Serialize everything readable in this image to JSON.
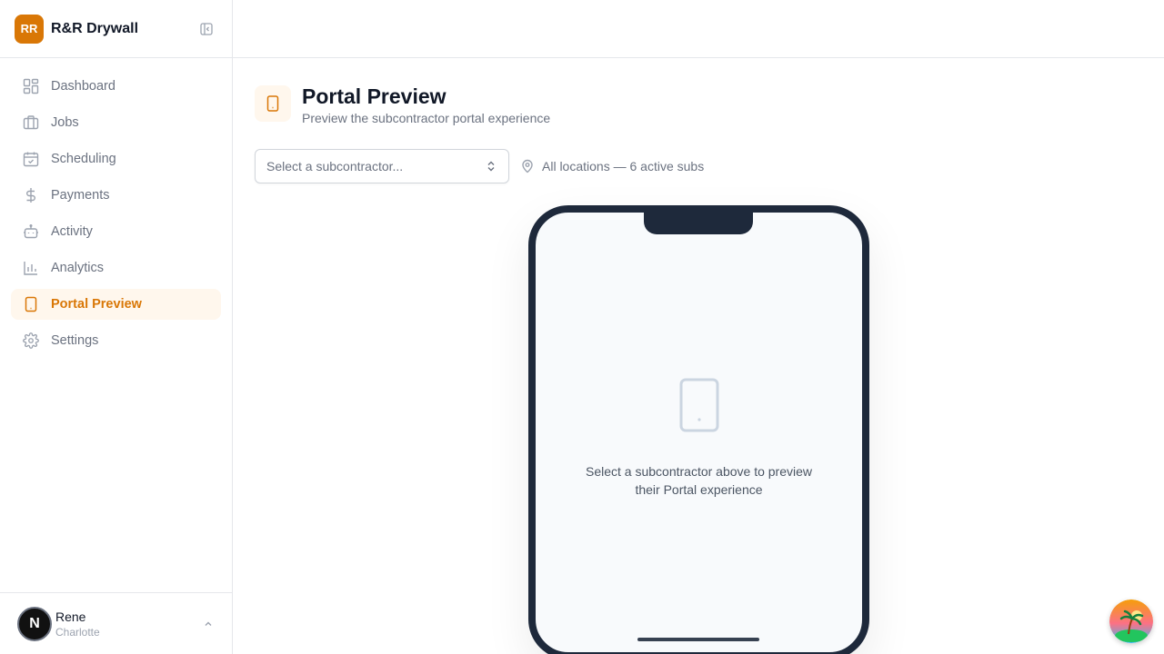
{
  "brand": {
    "initials": "RR",
    "name": "R&R Drywall"
  },
  "nav": [
    {
      "label": "Dashboard",
      "icon": "dashboard-icon"
    },
    {
      "label": "Jobs",
      "icon": "briefcase-icon"
    },
    {
      "label": "Scheduling",
      "icon": "calendar-check-icon"
    },
    {
      "label": "Payments",
      "icon": "dollar-icon"
    },
    {
      "label": "Activity",
      "icon": "bot-icon"
    },
    {
      "label": "Analytics",
      "icon": "bar-chart-icon"
    },
    {
      "label": "Portal Preview",
      "icon": "tablet-icon",
      "active": true
    },
    {
      "label": "Settings",
      "icon": "gear-icon"
    }
  ],
  "user": {
    "initial": "N",
    "name": "Rene",
    "location": "Charlotte"
  },
  "page": {
    "title": "Portal Preview",
    "subtitle": "Preview the subcontractor portal experience"
  },
  "select": {
    "placeholder": "Select a subcontractor..."
  },
  "location_summary": "All locations — 6 active subs",
  "phone": {
    "empty_line1": "Select a subcontractor above to preview",
    "empty_line2": "their Portal experience"
  },
  "colors": {
    "accent": "#d97706",
    "accent_bg": "#fff7ed",
    "phone_frame": "#1e293b"
  }
}
